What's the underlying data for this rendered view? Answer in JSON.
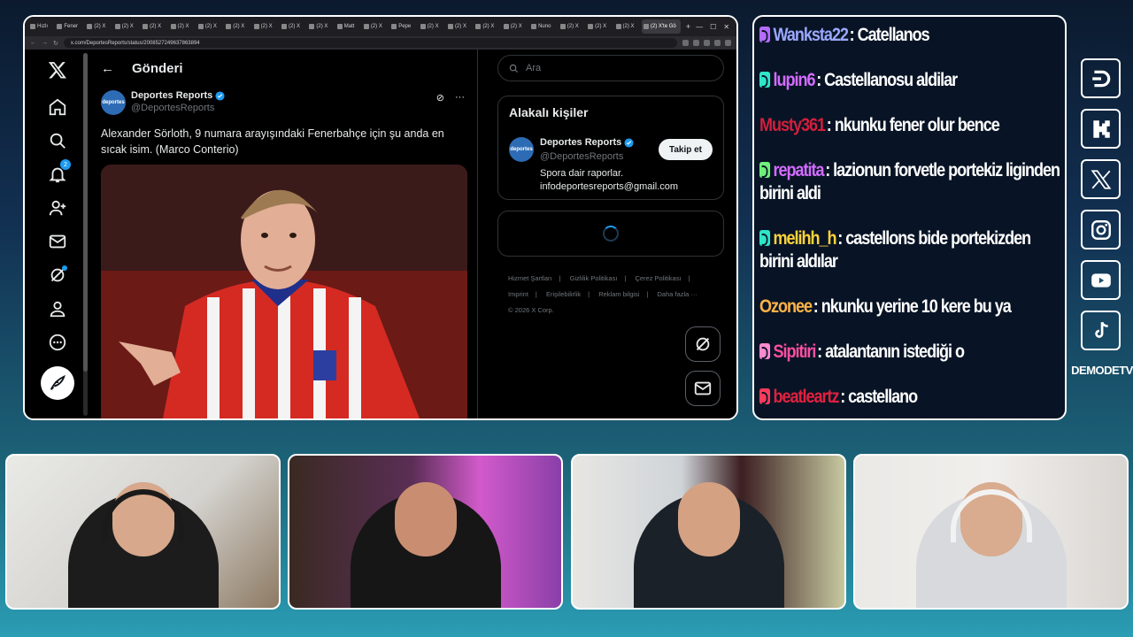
{
  "browser": {
    "tabs": [
      "Hızlı",
      "Fener",
      "(2) X",
      "(2) X",
      "(2) X",
      "(2) X",
      "(2) X",
      "(2) X",
      "(2) X",
      "(2) X",
      "(2) X",
      "Matt",
      "(2) X",
      "Pepe",
      "(2) X",
      "(2) X",
      "(2) X",
      "(2) X",
      "Nuno",
      "(2) X",
      "(2) X",
      "(2) X",
      "(2) X'te Gö"
    ],
    "url": "x.com/DeportesReports/status/2008527249637863894"
  },
  "x": {
    "page_title": "Gönderi",
    "notification_count": "2",
    "post": {
      "author_name": "Deportes Reports",
      "author_handle": "@DeportesReports",
      "avatar_text": "deportes",
      "text": "Alexander Sörloth, 9 numara arayışındaki Fenerbahçe için şu anda en sıcak isim. (Marco Conterio)"
    },
    "sidebar": {
      "search_placeholder": "Ara",
      "related_title": "Alakalı kişiler",
      "related_name": "Deportes Reports",
      "related_handle": "@DeportesReports",
      "related_bio_1": "Spora dair raporlar.",
      "related_bio_2": "infodeportesreports@gmail.com",
      "follow_label": "Takip et",
      "footer": [
        "Hizmet Şartları",
        "Gizlilik Politikası",
        "Çerez Politikası",
        "Imprint",
        "Erişilebilirlik",
        "Reklam bilgisi",
        "Daha fazla ···",
        "© 2026 X Corp."
      ]
    }
  },
  "chat": {
    "messages": [
      {
        "user": "Wanksta22",
        "text": ": Catellanos",
        "color": "#9aa8ff",
        "badge": "#b46cff"
      },
      {
        "user": "lupin6",
        "text": ": Castellanosu aldilar",
        "color": "#d36cff",
        "badge": "#2ee6c8"
      },
      {
        "user": "Musty361",
        "text": ": nkunku fener olur bence",
        "color": "#d21f3c",
        "badge": ""
      },
      {
        "user": "repatita",
        "text": ": lazionun forvetle portekiz liginden birini aldi",
        "color": "#d36cff",
        "badge": "#6ef07a"
      },
      {
        "user": "melihh_h",
        "text": ": castellons bide portekizden birini aldılar",
        "color": "#ffd23a",
        "badge": "#2ee6c8"
      },
      {
        "user": "Ozonee",
        "text": ": nkunku yerine 10 kere bu ya",
        "color": "#ffb347",
        "badge": ""
      },
      {
        "user": "Sipitiri",
        "text": ": atalantanın istediği o",
        "color": "#ff4fa3",
        "badge": "#ff8ad0"
      },
      {
        "user": "beatleartz",
        "text": ": castellano",
        "color": "#e0213f",
        "badge": "#ff3b5c"
      }
    ]
  },
  "socials": {
    "icons": [
      "dlive-icon",
      "kick-icon",
      "x-icon",
      "instagram-icon",
      "youtube-icon",
      "tiktok-icon"
    ],
    "label": "DEMODETV"
  }
}
